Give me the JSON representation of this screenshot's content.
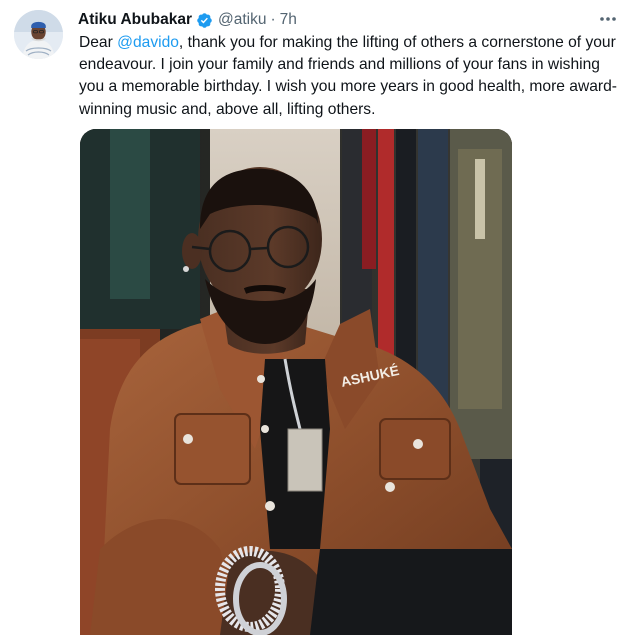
{
  "tweet": {
    "author_name": "Atiku Abubakar",
    "handle": "@atiku",
    "separator": "·",
    "time": "7h",
    "verified": true,
    "verified_icon": "verified-badge-icon",
    "more_icon": "more-options-icon",
    "text_prefix": "Dear ",
    "mention": "@davido",
    "text_rest": ", thank you for making the lifting of others a cornerstone of your endeavour. I join your family and friends and millions of your fans in wishing you a memorable birthday. I wish you more years in good health, more award-winning music and, above all, lifting others.",
    "jacket_label": "ASHUKÉ",
    "colors": {
      "accent": "#1d9bf0",
      "text": "#0f1419",
      "secondary": "#536471"
    }
  }
}
